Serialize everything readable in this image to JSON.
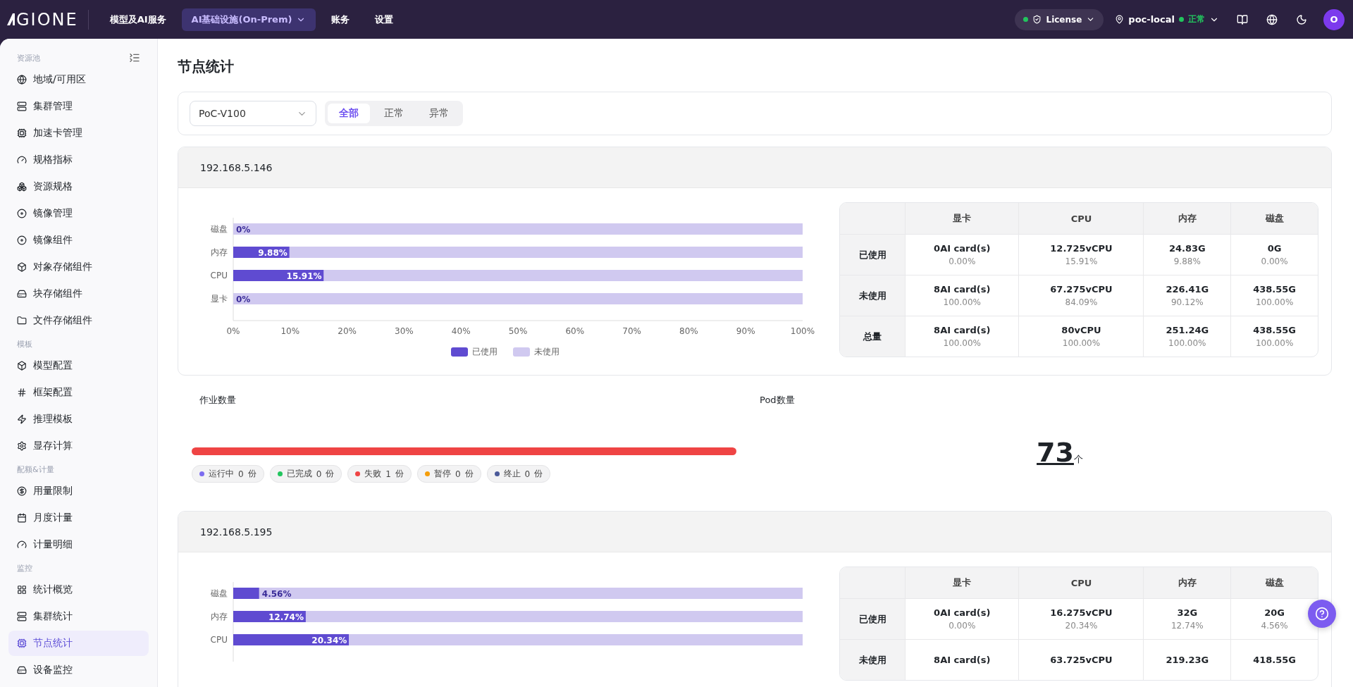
{
  "topbar": {
    "logo": "GIONE",
    "nav": [
      {
        "label": "模型及AI服务",
        "selected": false
      },
      {
        "label": "AI基础设施(On-Prem)",
        "selected": true
      },
      {
        "label": "账务",
        "selected": false
      },
      {
        "label": "设置",
        "selected": false
      }
    ],
    "license": {
      "label": "License",
      "online": true
    },
    "cluster": {
      "name": "poc-local",
      "status": "正常",
      "online": true
    },
    "avatar": "O"
  },
  "sidebar": {
    "groups": [
      {
        "title": "资源池",
        "items": [
          {
            "label": "地域/可用区",
            "selected": false
          },
          {
            "label": "集群管理",
            "selected": false
          },
          {
            "label": "加速卡管理",
            "selected": false
          },
          {
            "label": "规格指标",
            "selected": false
          },
          {
            "label": "资源规格",
            "selected": false
          },
          {
            "label": "镜像管理",
            "selected": false
          },
          {
            "label": "镜像组件",
            "selected": false
          },
          {
            "label": "对象存储组件",
            "selected": false
          },
          {
            "label": "块存储组件",
            "selected": false
          },
          {
            "label": "文件存储组件",
            "selected": false
          }
        ]
      },
      {
        "title": "模板",
        "items": [
          {
            "label": "模型配置",
            "selected": false
          },
          {
            "label": "框架配置",
            "selected": false
          },
          {
            "label": "推理模板",
            "selected": false
          },
          {
            "label": "显存计算",
            "selected": false
          }
        ]
      },
      {
        "title": "配额&计量",
        "items": [
          {
            "label": "用量限制",
            "selected": false
          },
          {
            "label": "月度计量",
            "selected": false
          },
          {
            "label": "计量明细",
            "selected": false
          }
        ]
      },
      {
        "title": "监控",
        "items": [
          {
            "label": "统计概览",
            "selected": false
          },
          {
            "label": "集群统计",
            "selected": false
          },
          {
            "label": "节点统计",
            "selected": true
          },
          {
            "label": "设备监控",
            "selected": false
          }
        ]
      }
    ]
  },
  "page": {
    "title": "节点统计",
    "filter": {
      "cluster": "PoC-V100",
      "tabs": [
        {
          "label": "全部",
          "selected": true
        },
        {
          "label": "正常",
          "selected": false
        },
        {
          "label": "异常",
          "selected": false
        }
      ]
    },
    "nodes": [
      {
        "ip": "192.168.5.146",
        "chart_data": {
          "type": "bar",
          "orientation": "horizontal",
          "stacked": true,
          "categories": [
            "磁盘",
            "内存",
            "CPU",
            "显卡"
          ],
          "series": [
            {
              "name": "已使用",
              "color": "#5f4bd1",
              "values": [
                0,
                9.88,
                15.91,
                0
              ]
            },
            {
              "name": "未使用",
              "color": "#d0c9f0",
              "values": [
                100,
                90.12,
                84.09,
                100
              ]
            }
          ],
          "value_labels": [
            "0%",
            "9.88%",
            "15.91%",
            "0%"
          ],
          "xlim": [
            0,
            100
          ],
          "xticks": [
            {
              "value": 0,
              "label": "0%"
            },
            {
              "value": 10,
              "label": "10%"
            },
            {
              "value": 20,
              "label": "20%"
            },
            {
              "value": 30,
              "label": "30%"
            },
            {
              "value": 40,
              "label": "40%"
            },
            {
              "value": 50,
              "label": "50%"
            },
            {
              "value": 60,
              "label": "60%"
            },
            {
              "value": 70,
              "label": "70%"
            },
            {
              "value": 80,
              "label": "80%"
            },
            {
              "value": 90,
              "label": "90%"
            },
            {
              "value": 100,
              "label": "100%"
            }
          ]
        },
        "table": {
          "columns": [
            "显卡",
            "CPU",
            "内存",
            "磁盘"
          ],
          "rows": [
            {
              "label": "已使用",
              "cells": [
                {
                  "value": "0AI card(s)",
                  "percent": "0.00%"
                },
                {
                  "value": "12.725vCPU",
                  "percent": "15.91%"
                },
                {
                  "value": "24.83G",
                  "percent": "9.88%"
                },
                {
                  "value": "0G",
                  "percent": "0.00%"
                }
              ]
            },
            {
              "label": "未使用",
              "cells": [
                {
                  "value": "8AI card(s)",
                  "percent": "100.00%"
                },
                {
                  "value": "67.275vCPU",
                  "percent": "84.09%"
                },
                {
                  "value": "226.41G",
                  "percent": "90.12%"
                },
                {
                  "value": "438.55G",
                  "percent": "100.00%"
                }
              ]
            },
            {
              "label": "总量",
              "cells": [
                {
                  "value": "8AI card(s)",
                  "percent": "100.00%"
                },
                {
                  "value": "80vCPU",
                  "percent": "100.00%"
                },
                {
                  "value": "251.24G",
                  "percent": "100.00%"
                },
                {
                  "value": "438.55G",
                  "percent": "100.00%"
                }
              ]
            }
          ]
        },
        "jobs": {
          "title": "作业数量",
          "level": 1,
          "statuses": [
            {
              "label": "运行中",
              "count": "0",
              "unit": "份",
              "color": "#7c6cf0"
            },
            {
              "label": "已完成",
              "count": "0",
              "unit": "份",
              "color": "#22c55e"
            },
            {
              "label": "失败",
              "count": "1",
              "unit": "份",
              "color": "#ef4444"
            },
            {
              "label": "暂停",
              "count": "0",
              "unit": "份",
              "color": "#f59e0b"
            },
            {
              "label": "终止",
              "count": "0",
              "unit": "份",
              "color": "#4b5a9a"
            }
          ]
        },
        "pods": {
          "title": "Pod数量",
          "count": "73",
          "unit": "个"
        }
      },
      {
        "ip": "192.168.5.195",
        "chart_data": {
          "type": "bar",
          "orientation": "horizontal",
          "stacked": true,
          "categories": [
            "磁盘",
            "内存",
            "CPU"
          ],
          "series": [
            {
              "color": "#5f4bd1",
              "values": [
                4.56,
                12.74,
                20.34
              ]
            },
            {
              "color": "#d0c9f0",
              "values": [
                95.44,
                87.26,
                79.66
              ]
            }
          ],
          "value_labels": [
            "4.56%",
            "12.74%",
            "20.34%"
          ],
          "xlim": [
            0,
            100
          ]
        },
        "table": {
          "columns": [
            "显卡",
            "CPU",
            "内存",
            "磁盘"
          ],
          "rows": [
            {
              "label": "已使用",
              "cells": [
                {
                  "value": "0AI card(s)",
                  "percent": "0.00%"
                },
                {
                  "value": "16.275vCPU",
                  "percent": "20.34%"
                },
                {
                  "value": "32G",
                  "percent": "12.74%"
                },
                {
                  "value": "20G",
                  "percent": "4.56%"
                }
              ]
            },
            {
              "label": "未使用",
              "cells": [
                {
                  "value": "8AI card(s)"
                },
                {
                  "value": "63.725vCPU"
                },
                {
                  "value": "219.23G"
                },
                {
                  "value": "418.55G"
                }
              ]
            }
          ]
        }
      }
    ]
  }
}
